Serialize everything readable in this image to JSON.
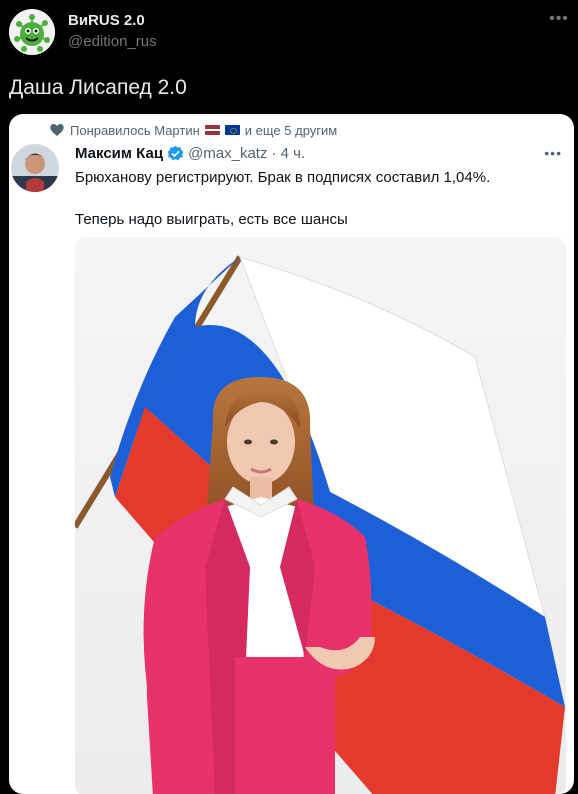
{
  "tweet": {
    "author_name": "ВиRUS 2.0",
    "author_handle": "@edition_rus",
    "more_icon": "more-icon",
    "text": "Даша Лисапед 2.0"
  },
  "quoted": {
    "liked_prefix": "Понравилось Мартин",
    "liked_suffix": "и еще 5 другим",
    "author_name": "Максим Кац",
    "author_handle": "@max_katz",
    "time": "· 4 ч.",
    "text_line1": "Брюханову регистрируют. Брак в подписях составил 1,04%.",
    "text_line2": "Теперь надо выиграть, есть все шансы",
    "verified_icon": "verified-badge-icon"
  },
  "colors": {
    "background": "#000000",
    "text_primary": "#e7e9ea",
    "text_secondary": "#71767b",
    "verified": "#1d9bf0",
    "flag_blue": "#1c5fd6",
    "flag_red": "#e33a2c",
    "suit_pink": "#e8326b"
  }
}
